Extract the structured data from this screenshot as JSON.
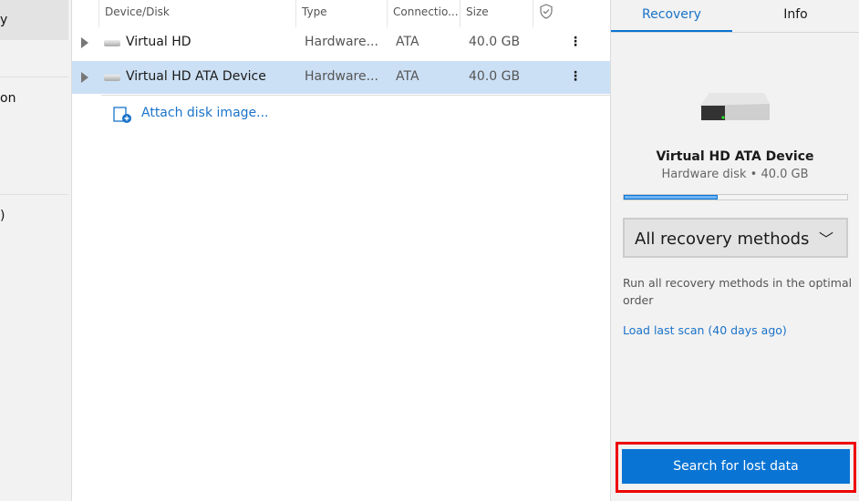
{
  "sidebar": {
    "items": [
      {
        "label": "y"
      },
      {
        "label": "on"
      },
      {
        "label": ")"
      }
    ]
  },
  "table": {
    "columns": [
      "Device/Disk",
      "Type",
      "Connectio...",
      "Size"
    ],
    "rows": [
      {
        "name": "Virtual HD",
        "type": "Hardware...",
        "connection": "ATA",
        "size": "40.0 GB",
        "selected": false
      },
      {
        "name": "Virtual HD ATA Device",
        "type": "Hardware...",
        "connection": "ATA",
        "size": "40.0 GB",
        "selected": true
      }
    ],
    "attach_label": "Attach disk image..."
  },
  "panel": {
    "tabs": [
      {
        "label": "Recovery",
        "active": true
      },
      {
        "label": "Info",
        "active": false
      }
    ],
    "device_name": "Virtual HD ATA Device",
    "device_sub": "Hardware disk • 40.0 GB",
    "usage_percent": 42,
    "method": "All recovery methods",
    "description": "Run all recovery methods in the optimal order",
    "load_link": "Load last scan (40 days ago)",
    "search_button": "Search for lost data"
  },
  "colors": {
    "accent": "#0a74d4",
    "selected_row": "#cce0f5",
    "highlight": "#e00000"
  }
}
